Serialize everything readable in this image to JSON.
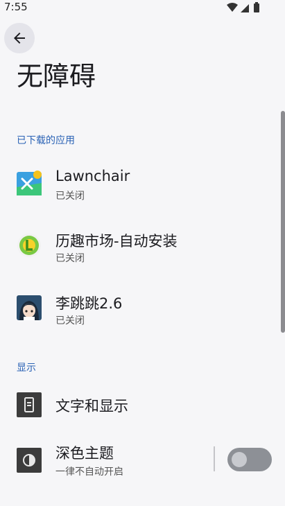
{
  "status_bar": {
    "time": "7:55"
  },
  "page": {
    "title": "无障碍"
  },
  "sections": {
    "downloaded": {
      "header": "已下载的应用",
      "items": [
        {
          "title": "Lawnchair",
          "subtitle": "已关闭",
          "icon": "lawnchair-icon"
        },
        {
          "title": "历趣市场-自动安装",
          "subtitle": "已关闭",
          "icon": "liqu-market-icon"
        },
        {
          "title": "李跳跳2.6",
          "subtitle": "已关闭",
          "icon": "litiaotiao-icon"
        }
      ]
    },
    "display": {
      "header": "显示",
      "items": [
        {
          "title": "文字和显示",
          "icon": "text-display-icon"
        },
        {
          "title": "深色主题",
          "subtitle": "一律不自动开启",
          "icon": "dark-theme-icon",
          "toggle_on": false
        }
      ]
    }
  },
  "colors": {
    "accent": "#2a62b5",
    "background": "#f6f6f8",
    "icon_dark": "#3c3c3c"
  }
}
